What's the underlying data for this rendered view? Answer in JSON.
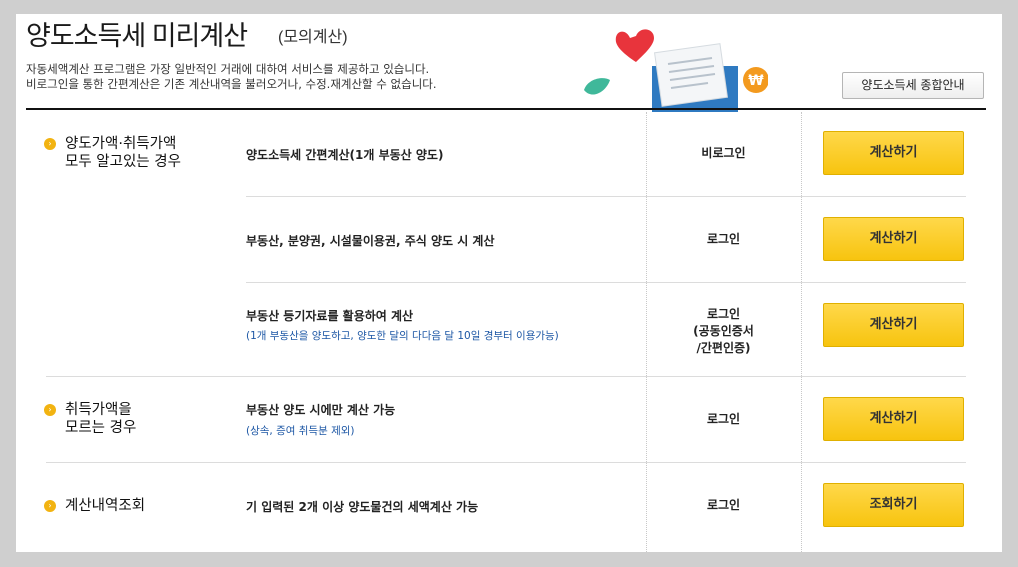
{
  "header": {
    "title": "양도소득세 미리계산",
    "subtitle": "(모의계산)",
    "desc_line1": "자동세액계산 프로그램은 가장 일반적인 거래에 대하여 서비스를 제공하고 있습니다.",
    "desc_line2": "비로그인을 통한 간편계산은 기존 계산내역을 불러오거나, 수정.재계산할 수 없습니다.",
    "guide_button": "양도소득세 종합안내"
  },
  "sections": [
    {
      "category_line1": "양도가액·취득가액",
      "category_line2": "모두 알고있는 경우",
      "rows": [
        {
          "main": "양도소득세 간편계산(1개 부동산 양도)",
          "sub": "",
          "login": "비로그인",
          "button": "계산하기"
        },
        {
          "main": "부동산, 분양권, 시설물이용권, 주식 양도 시 계산",
          "sub": "",
          "login": "로그인",
          "button": "계산하기"
        },
        {
          "main": "부동산 등기자료를 활용하여 계산",
          "sub": "(1개 부동산을 양도하고, 양도한 달의 다다음 달 10일 경부터 이용가능)",
          "login_line1": "로그인",
          "login_line2": "(공동인증서",
          "login_line3": "/간편인증)",
          "button": "계산하기"
        }
      ]
    },
    {
      "category_line1": "취득가액을",
      "category_line2": "모르는 경우",
      "rows": [
        {
          "main": "부동산 양도 시에만 계산 가능",
          "sub": "(상속, 증여 취득분 제외)",
          "login": "로그인",
          "button": "계산하기"
        }
      ]
    },
    {
      "category_line1": "계산내역조회",
      "rows": [
        {
          "main": "기 입력된 2개 이상 양도물건의 세액계산 가능",
          "sub": "",
          "login": "로그인",
          "button": "조회하기"
        }
      ]
    }
  ],
  "colors": {
    "accent": "#f7c40f",
    "link_blue": "#1d57a5",
    "bullet": "#f2b311"
  }
}
